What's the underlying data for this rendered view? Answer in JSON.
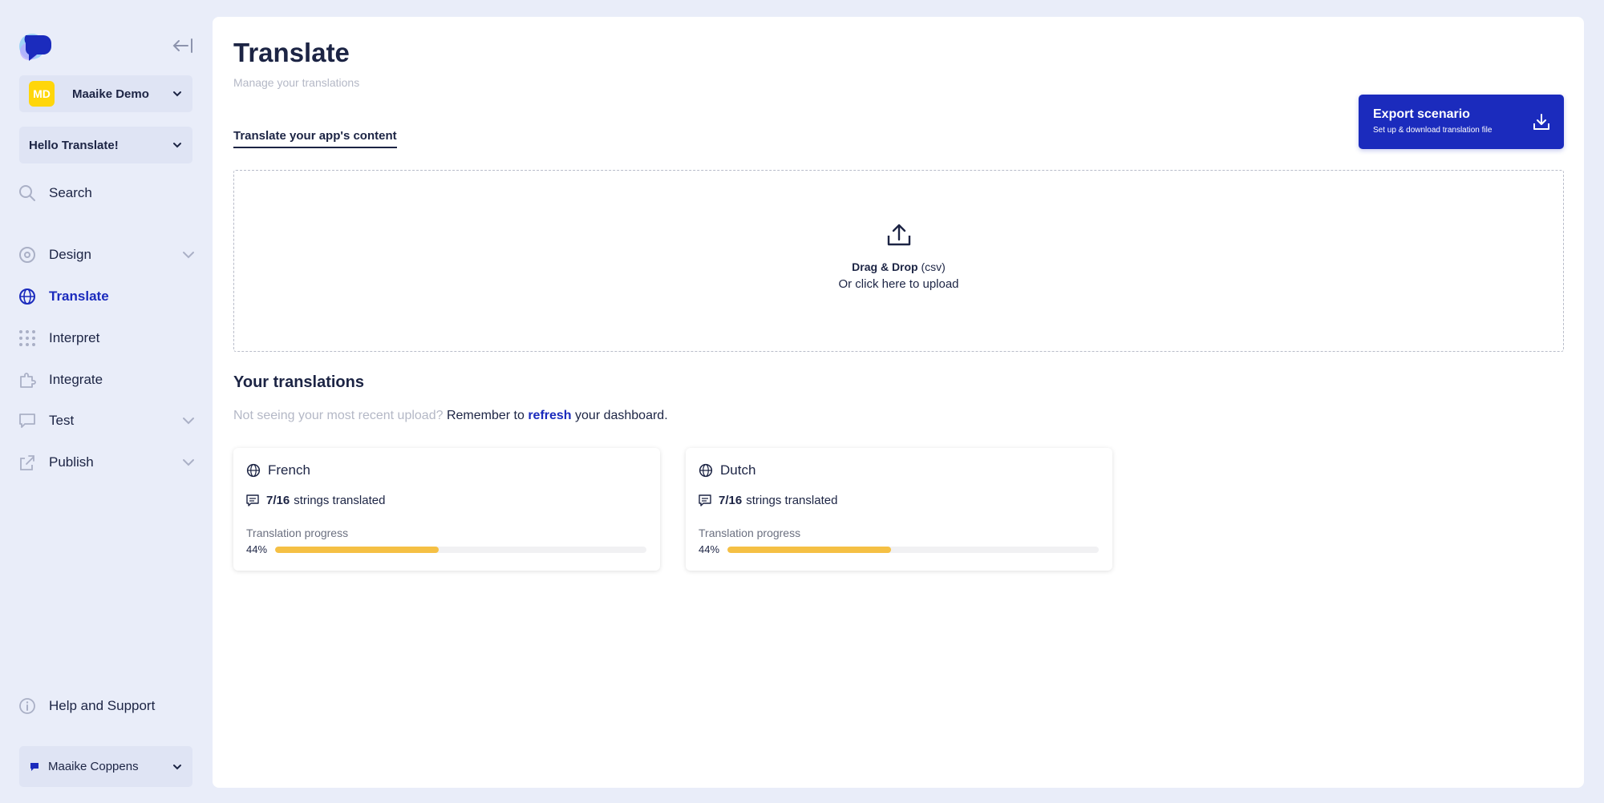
{
  "sidebar": {
    "org": {
      "initials": "MD",
      "name": "Maaike Demo",
      "avatar_color": "#ffd60a"
    },
    "app": {
      "name": "Hello Translate!"
    },
    "nav": [
      {
        "label": "Search",
        "icon": "search-icon",
        "expandable": false,
        "active": false
      },
      {
        "label": "Design",
        "icon": "palette-icon",
        "expandable": true,
        "active": false
      },
      {
        "label": "Translate",
        "icon": "globe-icon",
        "expandable": false,
        "active": true
      },
      {
        "label": "Interpret",
        "icon": "dots-grid-icon",
        "expandable": false,
        "active": false
      },
      {
        "label": "Integrate",
        "icon": "puzzle-icon",
        "expandable": false,
        "active": false
      },
      {
        "label": "Test",
        "icon": "chat-bubble-icon",
        "expandable": true,
        "active": false
      },
      {
        "label": "Publish",
        "icon": "share-icon",
        "expandable": true,
        "active": false
      }
    ],
    "help": "Help and Support",
    "user": {
      "name": "Maaike Coppens"
    }
  },
  "main": {
    "title": "Translate",
    "subtitle": "Manage your translations",
    "tab": "Translate your app's content",
    "export": {
      "title": "Export scenario",
      "subtitle": "Set up & download translation file"
    },
    "dropzone": {
      "strong": "Drag & Drop",
      "format": "(csv)",
      "line2": "Or click here to upload"
    },
    "section_title": "Your translations",
    "hint": {
      "muted": "Not seeing your most recent upload?",
      "before": "Remember to",
      "link": "refresh",
      "after": "your dashboard."
    },
    "translations": [
      {
        "language": "French",
        "count": "7/16",
        "strings_label": "strings translated",
        "progress_label": "Translation progress",
        "percent": "44%",
        "progress": 0.44
      },
      {
        "language": "Dutch",
        "count": "7/16",
        "strings_label": "strings translated",
        "progress_label": "Translation progress",
        "percent": "44%",
        "progress": 0.44
      }
    ]
  },
  "colors": {
    "accent": "#1b2bbd",
    "progress": "#f5c044",
    "background": "#e9edf9"
  }
}
